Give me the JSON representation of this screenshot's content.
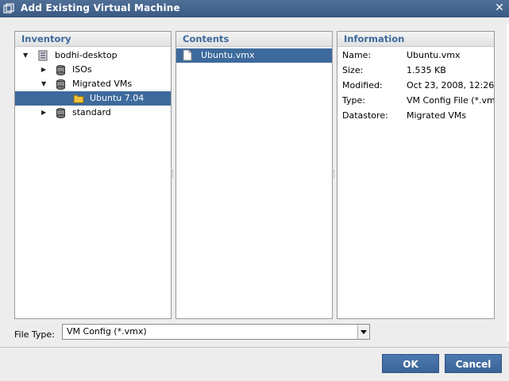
{
  "window": {
    "title": "Add Existing Virtual Machine"
  },
  "inventory": {
    "header": "Inventory",
    "items": [
      {
        "label": "bodhi-desktop",
        "expanded": true,
        "icon": "server-icon"
      },
      {
        "label": "ISOs",
        "expanded": false,
        "icon": "datastore-icon"
      },
      {
        "label": "Migrated VMs",
        "expanded": true,
        "icon": "datastore-icon"
      },
      {
        "label": "Ubuntu 7.04",
        "selected": true,
        "icon": "folder-icon"
      },
      {
        "label": "standard",
        "expanded": false,
        "icon": "datastore-icon"
      }
    ]
  },
  "contents": {
    "header": "Contents",
    "items": [
      {
        "label": "Ubuntu.vmx",
        "selected": true,
        "icon": "file-icon"
      }
    ]
  },
  "information": {
    "header": "Information",
    "rows": [
      {
        "key": "Name:",
        "value": "Ubuntu.vmx"
      },
      {
        "key": "Size:",
        "value": "1.535 KB"
      },
      {
        "key": "Modified:",
        "value": "Oct 23, 2008, 12:26"
      },
      {
        "key": "Type:",
        "value": "VM Config File (*.vmx"
      },
      {
        "key": "Datastore:",
        "value": "Migrated VMs"
      }
    ]
  },
  "file_type": {
    "label": "File Type:",
    "value": "VM Config (*.vmx)"
  },
  "buttons": {
    "ok": "OK",
    "cancel": "Cancel"
  },
  "colors": {
    "accent": "#3d6a9c",
    "title_bar": "#3a5a83",
    "header_text": "#3d6a9c"
  }
}
